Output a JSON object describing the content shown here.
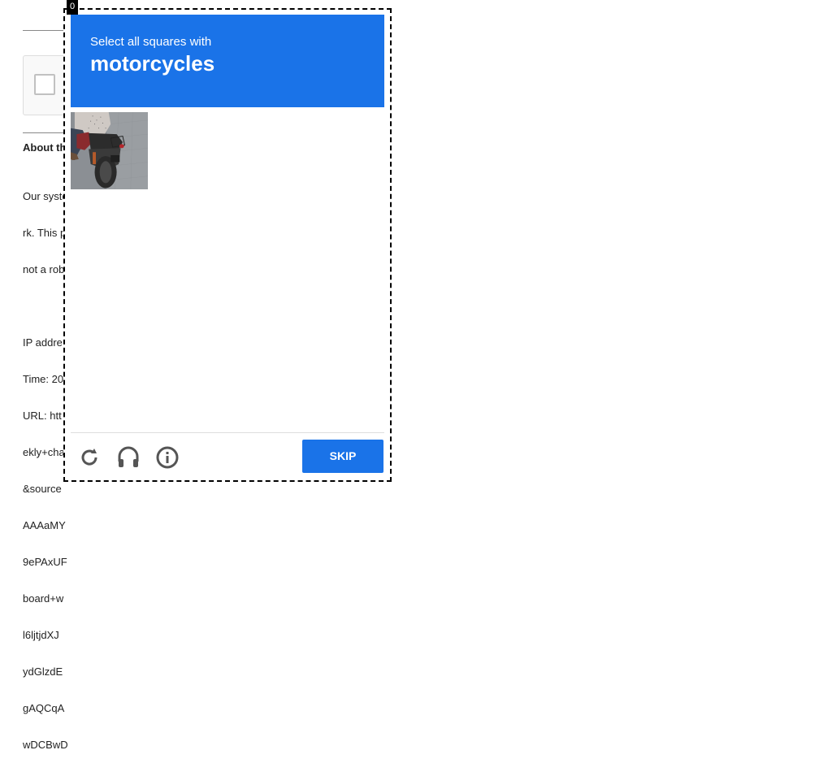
{
  "background_page": {
    "about_title": "About th",
    "lines": [
      "Our syste",
      "rk. This p",
      "not a rob",
      "",
      "IP addre",
      "Time: 20",
      "URL: htt",
      "ekly+cha",
      "&source",
      "AAAaMY",
      "9ePAxUF",
      "board+w",
      "l6ljtjdXJ",
      "ydGlzdE",
      "gAQCqA",
      "wDCBwD"
    ]
  },
  "frame_label": "0",
  "challenge": {
    "instruction": "Select all squares with",
    "target": "motorcycles",
    "header_color": "#1a73e8",
    "grid_rows": 4,
    "grid_cols": 4,
    "selected_tiles": []
  },
  "footer": {
    "reload_icon": "reload-icon",
    "audio_icon": "headphones-icon",
    "info_icon": "info-icon",
    "skip_label": "SKIP"
  }
}
